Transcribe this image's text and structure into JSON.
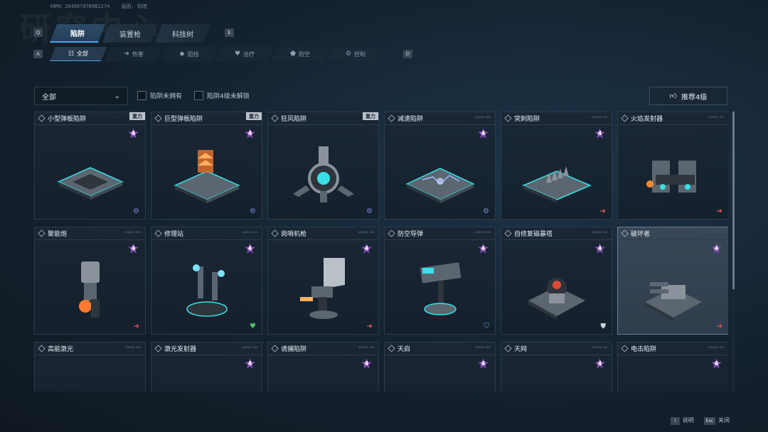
{
  "header": {
    "watermark": "研究中心",
    "build_id": "48MS 28468787B8B2274",
    "build_label": "画面: 较暗"
  },
  "keys": {
    "prev_main": "Q",
    "next_main": "E",
    "prev_sub": "A",
    "next_sub": "D"
  },
  "main_tabs": [
    {
      "label": "陷阱",
      "active": true
    },
    {
      "label": "装置枪",
      "active": false
    },
    {
      "label": "科技树",
      "active": false
    }
  ],
  "sub_tabs": [
    {
      "label": "全部",
      "icon": "list-icon",
      "glyph": "☷",
      "active": true
    },
    {
      "label": "伤害",
      "icon": "arrow-icon",
      "glyph": "➜",
      "active": false
    },
    {
      "label": "阻挡",
      "icon": "shield-icon",
      "glyph": "◆",
      "active": false
    },
    {
      "label": "治疗",
      "icon": "heart-icon",
      "glyph": "♥",
      "active": false
    },
    {
      "label": "防空",
      "icon": "shield-icon",
      "glyph": "⬟",
      "active": false
    },
    {
      "label": "控制",
      "icon": "gear-icon",
      "glyph": "⚙",
      "active": false
    }
  ],
  "filters": {
    "dropdown_value": "全部",
    "check_not_owned": "陷阱未拥有",
    "check_lv4_locked": "陷阱4级未解锁",
    "recommend_label": "推荐4级"
  },
  "cards": [
    {
      "name": "小型弹板陷阱",
      "badge": "重力",
      "level": "4",
      "corner": "gear",
      "art": "pad"
    },
    {
      "name": "巨型弹板陷阱",
      "badge": "重力",
      "level": "4",
      "corner": "gear",
      "art": "pad-fire"
    },
    {
      "name": "狂风陷阱",
      "badge": "重力",
      "level": "",
      "corner": "gear",
      "art": "fan"
    },
    {
      "name": "减速陷阱",
      "badge": "",
      "level": "4",
      "corner": "gear",
      "art": "pad-electric"
    },
    {
      "name": "突刺陷阱",
      "badge": "",
      "level": "4",
      "corner": "arrow",
      "art": "spikes"
    },
    {
      "name": "火焰发射器",
      "badge": "",
      "level": "",
      "corner": "arrow",
      "art": "flamer"
    },
    {
      "name": "聚能炮",
      "badge": "",
      "level": "4",
      "corner": "arrow",
      "art": "cannon"
    },
    {
      "name": "修理站",
      "badge": "",
      "level": "4",
      "corner": "heart",
      "art": "repair"
    },
    {
      "name": "岗哨机枪",
      "badge": "",
      "level": "4",
      "corner": "arrow",
      "art": "sentry"
    },
    {
      "name": "防空导弹",
      "badge": "",
      "level": "4",
      "corner": "shield-blue",
      "art": "missile"
    },
    {
      "name": "自修复磁暴塔",
      "badge": "",
      "level": "4",
      "corner": "shield",
      "art": "tesla"
    },
    {
      "name": "破坏者",
      "badge": "",
      "level": "4",
      "corner": "arrow",
      "art": "destroyer",
      "selected": true
    },
    {
      "name": "高能激光",
      "badge": "",
      "level": "",
      "corner": "",
      "art": "laser"
    },
    {
      "name": "激光发射器",
      "badge": "",
      "level": "4",
      "corner": "",
      "art": "laser-emitter"
    },
    {
      "name": "诱捕陷阱",
      "badge": "",
      "level": "4",
      "corner": "",
      "art": "lure"
    },
    {
      "name": "天启",
      "badge": "",
      "level": "4",
      "corner": "",
      "art": "apocalypse"
    },
    {
      "name": "天网",
      "badge": "",
      "level": "4",
      "corner": "",
      "art": "skynet"
    },
    {
      "name": "电击陷阱",
      "badge": "",
      "level": "4",
      "corner": "",
      "art": "shock"
    }
  ],
  "footer": {
    "help_key": "I",
    "help_label": "说明",
    "close_key": "Esc",
    "close_label": "关闭"
  },
  "colors": {
    "accent": "#4fa6e8",
    "glow": "#38e0e8",
    "level_badge": "#8a4ec0",
    "damage": "#e05858",
    "heal": "#54c070"
  }
}
